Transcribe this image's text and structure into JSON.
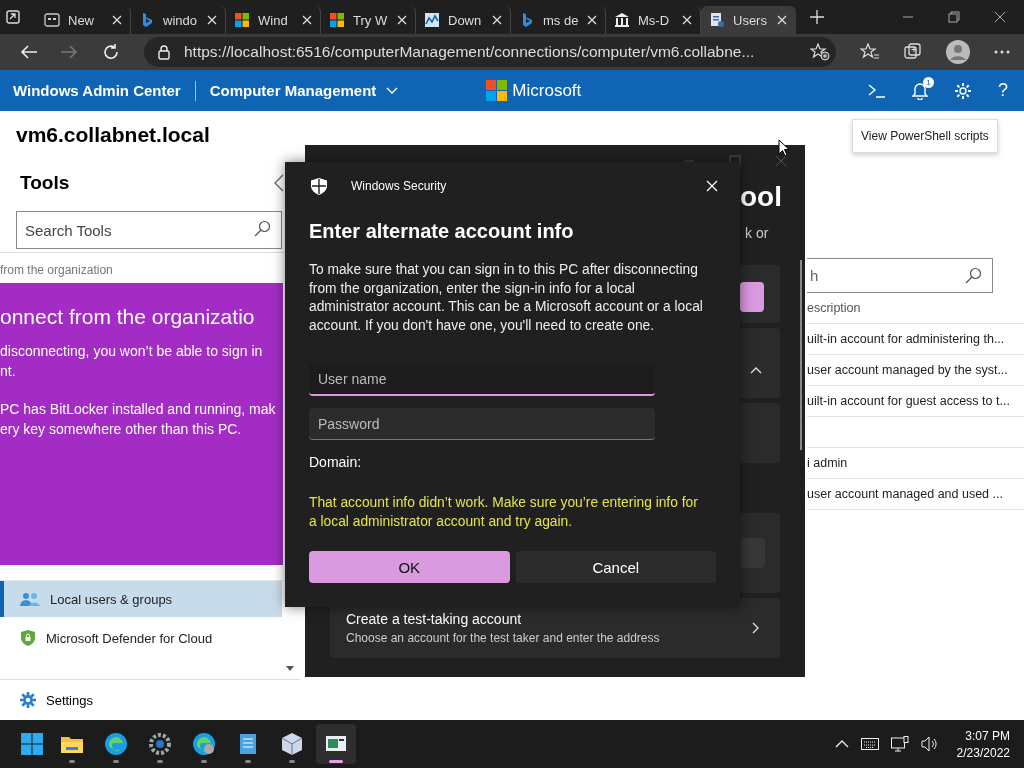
{
  "browser": {
    "tabs": [
      {
        "title": "New",
        "selected": false
      },
      {
        "title": "windo",
        "selected": false
      },
      {
        "title": "Wind",
        "selected": false
      },
      {
        "title": "Try W",
        "selected": false
      },
      {
        "title": "Down",
        "selected": false
      },
      {
        "title": "ms de",
        "selected": false
      },
      {
        "title": "Ms-D",
        "selected": false
      },
      {
        "title": "Users",
        "selected": true
      }
    ],
    "address": "https://localhost:6516/computerManagement/connections/computer/vm6.collabne..."
  },
  "header": {
    "app": "Windows Admin Center",
    "section": "Computer Management",
    "brand": "Microsoft",
    "notification_count": "1",
    "help": "?",
    "tooltip": "View PowerShell scripts"
  },
  "left_pane": {
    "server": "vm6.collabnet.local",
    "heading": "Tools",
    "search": {
      "placeholder": "Search Tools"
    },
    "remote_view": {
      "breadcrumb": "from the organization",
      "title": "onnect from the organizatio",
      "paragraphs": [
        [
          "disconnecting, you won’t be able to sign in",
          "nt."
        ],
        [
          "PC has BitLocker installed and running, mak",
          "ery key somewhere other than this PC."
        ]
      ]
    },
    "tools": [
      {
        "label": "Local users & groups",
        "selected": true
      },
      {
        "label": "Microsoft Defender for Cloud",
        "selected": false
      }
    ],
    "settings": "Settings"
  },
  "users_table": {
    "search": {
      "placeholder": "h"
    },
    "columns": [
      "escription"
    ],
    "rows": [
      {
        "kind": "text",
        "description": "uilt-in account for administering th..."
      },
      {
        "kind": "text",
        "description": "user account managed by the syst..."
      },
      {
        "kind": "text",
        "description": "uilt-in account for guest access to t..."
      },
      {
        "kind": "blank"
      },
      {
        "kind": "text",
        "description": "i admin"
      },
      {
        "kind": "text",
        "description": "user account managed and used ..."
      }
    ]
  },
  "settings_window": {
    "heading": "ool",
    "text": "k or",
    "card": {
      "title": "Create a test-taking account",
      "subtitle": "Choose an account for the test taker and enter the address"
    }
  },
  "dialog": {
    "app": "Windows Security",
    "title": "Enter alternate account info",
    "message": "To make sure that you can sign in to this PC after disconnecting from the organization, enter the sign-in info for a local administrator account. This can be a Microsoft account or a local account. If you don't have one, you'll need to create one.",
    "fields": [
      {
        "placeholder": "User name",
        "focused": true
      },
      {
        "placeholder": "Password",
        "focused": false
      }
    ],
    "domain_label": "Domain:",
    "error": "That account info didn’t work. Make sure you’re entering info for a local administrator account and try again.",
    "buttons": [
      {
        "label": "OK",
        "primary": true
      },
      {
        "label": "Cancel",
        "primary": false
      }
    ]
  },
  "taskbar": {
    "apps": [
      {
        "active": false
      },
      {
        "active": false
      },
      {
        "active": false
      },
      {
        "active": false
      },
      {
        "active": false
      },
      {
        "active": false
      },
      {
        "active": true
      }
    ],
    "time": "3:07 PM",
    "date": "2/23/2022"
  }
}
